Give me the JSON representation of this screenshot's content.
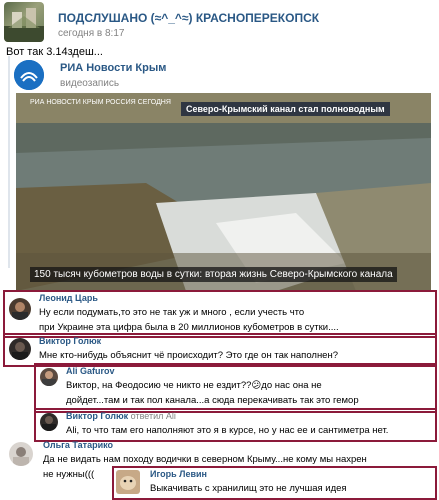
{
  "post": {
    "group_name": "ПОДСЛУШАНО (≈^_^≈) КРАСНОПЕРЕКОПСК",
    "time": "сегодня в 8:17",
    "text": "Вот так 3.14здеш..."
  },
  "repost": {
    "source_name": "РИА Новости Крым",
    "source_type": "видеозапись",
    "video_badge": "Северо-Крымский канал стал полноводным",
    "video_brand_line1": "РИА",
    "video_brand_line2": "НОВОСТИ",
    "video_brand_line3": "КРЫМ",
    "video_brand_line4": "РОССИЯ",
    "video_brand_line5": "СЕГОДНЯ",
    "video_caption": "150 тысяч кубометров воды в сутки: вторая жизнь Северо-Крымского канала"
  },
  "comments": [
    {
      "author": "Леонид Царь",
      "text_part1": "Ну если подумать,то это не так уж и много , если учесть что",
      "text_part2_pre": "при Украине эта цифра была ",
      "text_part2_hl": "в 20 миллионов кубометров в сутки",
      "text_part2_post": "...."
    },
    {
      "author": "Виктор Голюк",
      "text": "Мне кто-нибудь объяснит чё происходит? Это где он так наполнен?"
    },
    {
      "author": "Ali Gafurov",
      "text_line1": "Виктор, на Феодосию че никто не ездит??😕до нас она не",
      "text_line2": "дойдет...там и так пол канала...а сюда перекачивать так это гемор"
    },
    {
      "author": "Виктор Голюк",
      "reply_label": "ответил Ali",
      "text": "Ali, то что там его наполняют это я в курсе, но у нас ее и сантиметра нет."
    },
    {
      "author": "Ольга Татарико",
      "text_line1": "Да не видать нам походу водички в северном Крыму...не кому мы нахрен",
      "text_line2": "не нужны((("
    },
    {
      "author": "Игорь Левин",
      "text": "Выкачивать с хранилищ это не лучшая идея"
    }
  ],
  "colors": {
    "link": "#2a5885",
    "muted": "#828282",
    "highlight_box": "#8b1a3a",
    "underline": "#cc0000"
  },
  "icons": {
    "group_avatar": "group-avatar",
    "ria_logo": "ria-logo-icon",
    "avatars": "user-avatar"
  }
}
